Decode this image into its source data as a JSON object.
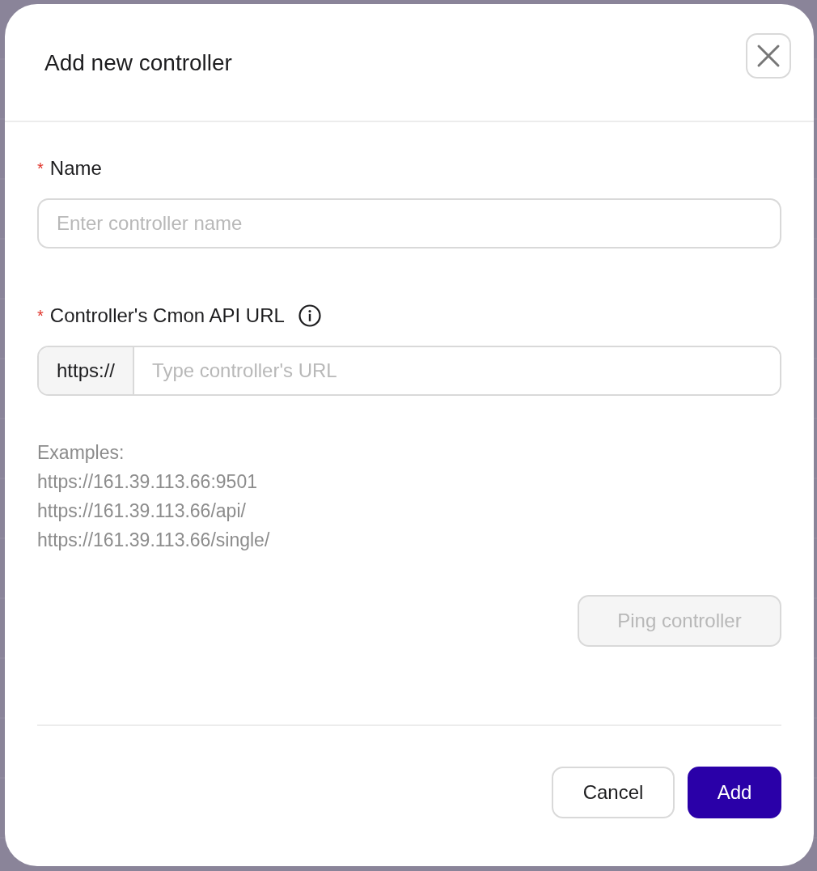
{
  "dialog": {
    "title": "Add new controller",
    "fields": [
      {
        "label": "Name",
        "required_mark": "*",
        "placeholder": "Enter controller name",
        "has_info": false
      },
      {
        "label": "Controller's Cmon API URL",
        "required_mark": "*",
        "prefix": "https://",
        "placeholder": "Type controller's URL",
        "has_info": true
      }
    ],
    "examples": [
      "Examples:",
      "https://161.39.113.66:9501",
      "https://161.39.113.66/api/",
      "https://161.39.113.66/single/"
    ],
    "ping_button": {
      "label": "Ping controller",
      "disabled": true
    },
    "buttons": [
      {
        "label": "Cancel",
        "kind": "secondary"
      },
      {
        "label": "Add",
        "kind": "primary"
      }
    ]
  }
}
